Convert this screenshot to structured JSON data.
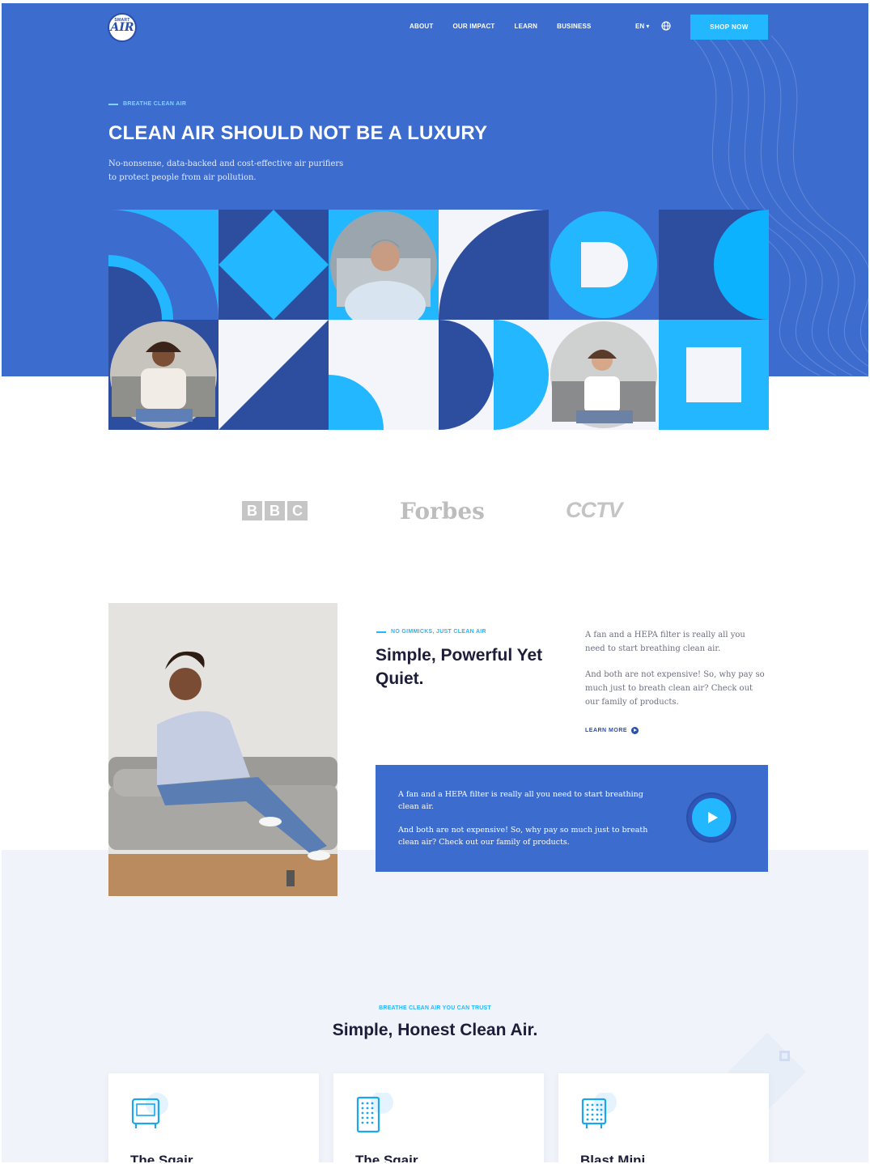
{
  "brand": {
    "logo_text": "AIR",
    "logo_top": "SMART"
  },
  "nav": {
    "links": [
      "ABOUT",
      "OUR IMPACT",
      "LEARN",
      "BUSINESS"
    ],
    "lang": "EN ▾",
    "shop_label": "SHOP NOW"
  },
  "hero": {
    "eyebrow": "BREATHE CLEAN AIR",
    "title": "CLEAN AIR SHOULD NOT BE A LUXURY",
    "subtitle_line1": "No-nonsense, data-backed and cost-effective air purifiers",
    "subtitle_line2": "to protect people from air pollution."
  },
  "press": {
    "bbc": [
      "B",
      "B",
      "C"
    ],
    "forbes": "Forbes",
    "cctv": "CCTV"
  },
  "feature": {
    "eyebrow": "NO GIMMICKS, JUST CLEAN AIR",
    "title": "Simple, Powerful Yet Quiet.",
    "text1": "A fan and a HEPA filter is really all you need to start breathing clean air.",
    "text2": "And both are not expensive! So, why pay so much just to breath clean air? Check out our family of products.",
    "learn_more": "LEARN MORE"
  },
  "video": {
    "text1": "A fan and a HEPA filter is really all you need to start breathing clean air.",
    "text2": "And both are not expensive! So, why pay so much just to breath clean air? Check out our family of products."
  },
  "products": {
    "eyebrow": "BREATHE CLEAN AIR YOU CAN TRUST",
    "title": "Simple, Honest Clean Air.",
    "items": [
      {
        "name": "The Sqair",
        "icon": "purifier-icon"
      },
      {
        "name": "The Sqair",
        "icon": "filter-grid-icon"
      },
      {
        "name": "Blast Mini",
        "icon": "filter-grid-icon"
      }
    ]
  },
  "colors": {
    "primary": "#3d6ccf",
    "accent": "#22b7ff",
    "navy": "#2a4fa8",
    "light_bg": "#f1f3fa"
  }
}
